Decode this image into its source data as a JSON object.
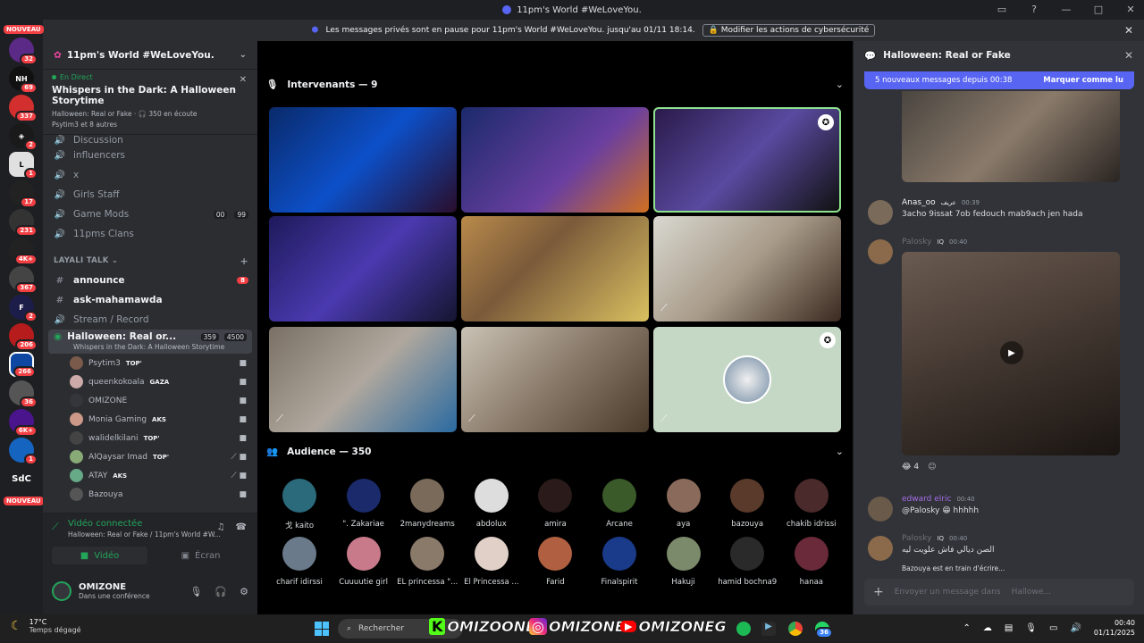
{
  "window": {
    "title": "11pm's World #WeLoveYou."
  },
  "banner": {
    "text": "Les messages privés sont en pause pour 11pm's World #WeLoveYou. jusqu'au 01/11 18:14.",
    "button": "Modifier les actions de cybersécurité"
  },
  "guilds": {
    "nouveau": "NOUVEAU",
    "nouveau2": "NOUVEAU",
    "badges": [
      "32",
      "69",
      "337",
      "2",
      "1",
      "17",
      "231",
      "4K+",
      "367",
      "2",
      "206",
      "266",
      "36",
      "6K+",
      "1"
    ],
    "sdc": "SdC"
  },
  "sidebar": {
    "server_name": "11pm's World #WeLoveYou.",
    "event": {
      "status": "En Direct",
      "title": "Whispers in the Dark: A Halloween Storytime",
      "meta": "Halloween: Real or Fake · 🎧 350 en écoute",
      "attendees": "Psytim3 et 8 autres"
    },
    "channels_top": [
      {
        "label": "Discussion"
      },
      {
        "label": "influencers"
      },
      {
        "label": "x"
      },
      {
        "label": "Girls Staff"
      },
      {
        "label": "Game Mods",
        "pill1": "00",
        "pill2": "99"
      },
      {
        "label": "11pms Clans"
      }
    ],
    "category": "LAYALI TALK",
    "channels": [
      {
        "label": "announce",
        "count": "8"
      },
      {
        "label": "ask-mahamawda"
      },
      {
        "label": "Stream / Record"
      }
    ],
    "active_channel": {
      "label": "Halloween: Real or...",
      "count1": "359",
      "count2": "4500",
      "sub": "Whispers in the Dark: A Halloween Storytime"
    },
    "members": [
      {
        "name": "Psytim3",
        "tag": "TOP'"
      },
      {
        "name": "queenkokoala",
        "tag": "GAZA"
      },
      {
        "name": "OMIZONE",
        "tag": ""
      },
      {
        "name": "Monia Gaming",
        "tag": "AKS"
      },
      {
        "name": "walidelkilani",
        "tag": "TOP'"
      },
      {
        "name": "AlQaysar Imad",
        "tag": "TOP'"
      },
      {
        "name": "ATAY",
        "tag": "AKS"
      },
      {
        "name": "Bazouya",
        "tag": ""
      }
    ],
    "voice": {
      "status": "Vidéo connectée",
      "channel": "Halloween: Real or Fake / 11pm's World #W...",
      "video_button": "Vidéo",
      "screen_button": "Écran"
    },
    "user": {
      "name": "OMIZONE",
      "status": "Dans une conférence"
    }
  },
  "stage": {
    "speakers_label": "Intervenants — 9",
    "audience_label": "Audience — 350",
    "audience": [
      "戈 kaito",
      "\". Zakariae",
      "2manydreams",
      "abdolux",
      "amira",
      "Arcane",
      "aya",
      "bazouya",
      "chakib idrissi",
      "charif idirssi",
      "Cuuuutie girl",
      "EL princessa \"...",
      "El Princessa ...",
      "Farid",
      "Finalspirit",
      "Hakuji",
      "hamid bochna9",
      "hanaa"
    ]
  },
  "chat": {
    "title": "Halloween: Real or Fake",
    "new_messages": "5 nouveaux messages depuis 00:38",
    "mark_read": "Marquer comme lu",
    "messages": [
      {
        "author": "Anas_oo",
        "tag": "عريف",
        "time": "00:39",
        "text": "3acho 9issat 7ob fedouch mab9ach jen hada"
      },
      {
        "author": "Palosky",
        "tag": "IQ",
        "time": "00:40",
        "text": ""
      },
      {
        "author": "edward elric",
        "tag": "",
        "time": "00:40",
        "text": "@Palosky 😁 hhhhh"
      },
      {
        "author": "Palosky",
        "tag": "IQ",
        "time": "00:40",
        "text": "الصن ديالي فاش علويت ليه"
      }
    ],
    "reaction_count": "4",
    "typing": "Bazouya est en train d'écrire...",
    "composer_placeholder": "Envoyer un message dans",
    "composer_channel": "Hallowe..."
  },
  "taskbar": {
    "temp": "17°C",
    "weather": "Temps dégagé",
    "search": "Rechercher",
    "brand1": "OMIZOONE",
    "brand2": "OMIZONE",
    "brand3": "OMIZONEG",
    "time": "00:40",
    "date": "01/11/2025",
    "notif": "36"
  }
}
